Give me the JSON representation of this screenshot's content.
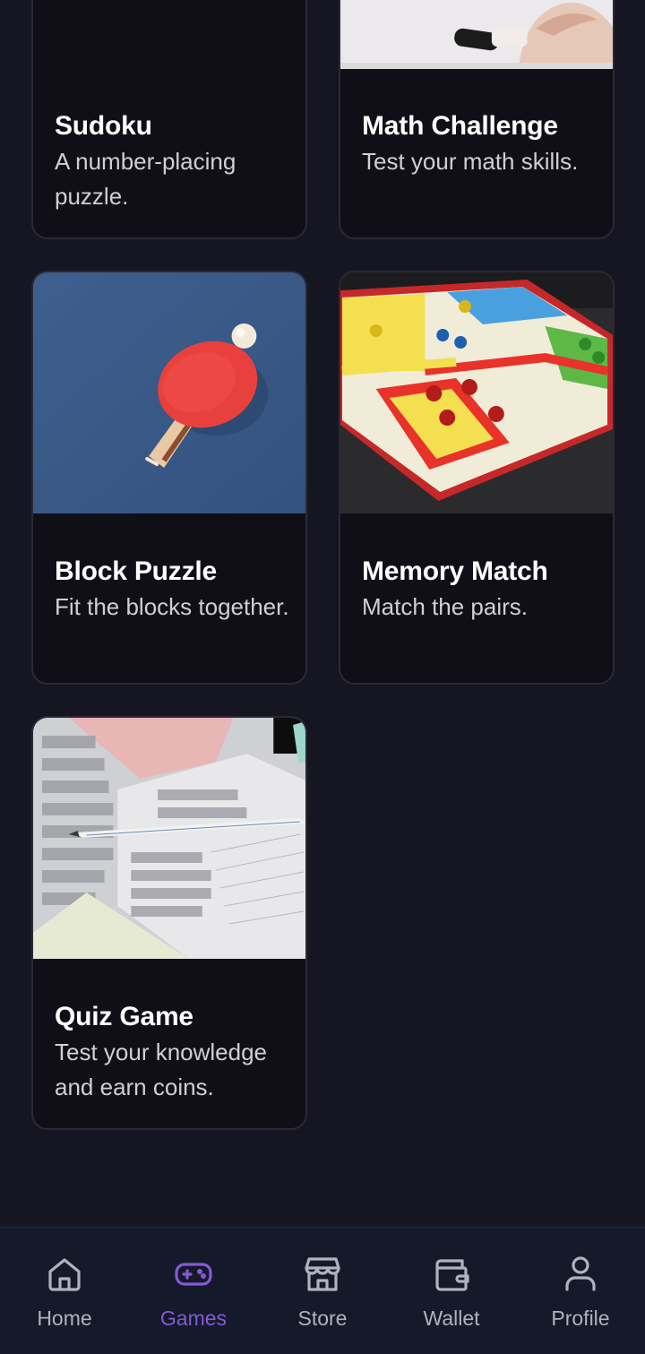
{
  "colors": {
    "background": "#161522",
    "card": "#100f18",
    "accent": "#8758d6",
    "nav_inactive": "#aeb3c2"
  },
  "games": [
    {
      "title": "Sudoku",
      "description": "A number-placing puzzle.",
      "image": "none"
    },
    {
      "title": "Math Challenge",
      "description": "Test your math skills.",
      "image": "whiteboard-hand-marker"
    },
    {
      "title": "Block Puzzle",
      "description": "Fit the blocks together.",
      "image": "ping-pong-paddle-blue"
    },
    {
      "title": "Memory Match",
      "description": "Match the pairs.",
      "image": "ludo-board"
    },
    {
      "title": "Quiz Game",
      "description": "Test your knowledge and earn coins.",
      "image": "answer-sheet-pencil"
    }
  ],
  "nav": {
    "active": "Games",
    "items": [
      {
        "label": "Home",
        "icon": "home-icon"
      },
      {
        "label": "Games",
        "icon": "gamepad-icon"
      },
      {
        "label": "Store",
        "icon": "store-icon"
      },
      {
        "label": "Wallet",
        "icon": "wallet-icon"
      },
      {
        "label": "Profile",
        "icon": "person-icon"
      }
    ]
  }
}
